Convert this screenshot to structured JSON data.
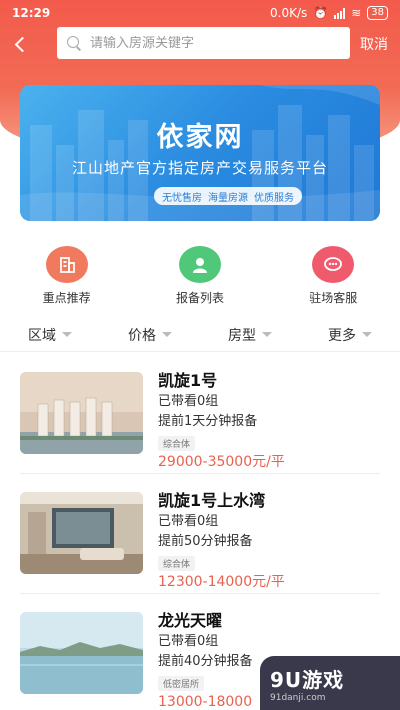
{
  "status": {
    "time": "12:29",
    "speed": "0.0K/s",
    "battery": "38"
  },
  "search": {
    "placeholder": "请输入房源关键字",
    "cancel_label": "取消"
  },
  "banner": {
    "title": "依家网",
    "subtitle": "江山地产官方指定房产交易服务平台",
    "tags": [
      "无忧售房",
      "海量房源",
      "优质服务"
    ]
  },
  "quick_actions": [
    {
      "label": "重点推荐",
      "icon": "building-icon",
      "color": "#f0795e"
    },
    {
      "label": "报备列表",
      "icon": "user-icon",
      "color": "#4fc87a"
    },
    {
      "label": "驻场客服",
      "icon": "chat-icon",
      "color": "#ef5b6d"
    }
  ],
  "filters": [
    "区域",
    "价格",
    "房型",
    "更多"
  ],
  "listings": [
    {
      "name": "凯旋1号",
      "viewed": "已带看0组",
      "advance": "提前1天分钟报备",
      "tag": "综合体",
      "price": "29000-35000元/平"
    },
    {
      "name": "凯旋1号上水湾",
      "viewed": "已带看0组",
      "advance": "提前50分钟报备",
      "tag": "综合体",
      "price": "12300-14000元/平"
    },
    {
      "name": "龙光天曜",
      "viewed": "已带看0组",
      "advance": "提前40分钟报备",
      "tag": "低密居所",
      "price": "13000-18000"
    }
  ],
  "watermark": {
    "logo": "9U游戏",
    "url": "91danji.com"
  }
}
